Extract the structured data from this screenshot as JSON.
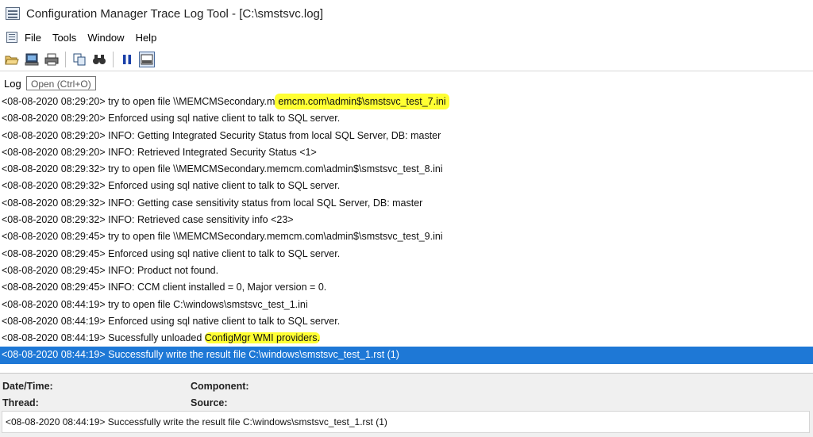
{
  "window": {
    "title": "Configuration Manager Trace Log Tool - [C:\\smstsvc.log]"
  },
  "menu": {
    "items": [
      "File",
      "Tools",
      "Window",
      "Help"
    ]
  },
  "toolbar": {
    "buttons": [
      "open-folder-icon",
      "computer-icon",
      "print-icon",
      "copy-icon",
      "find-icon",
      "pause-icon",
      "detail-pane-icon"
    ]
  },
  "log_header": {
    "label": "Log",
    "tooltip": "Open (Ctrl+O)"
  },
  "log_rows": [
    {
      "time": "<08-08-2020 08:29:20>",
      "text": " try to open file \\\\MEMCMSecondary.m",
      "hl": "emcm.com\\admin$\\smstsvc_test_7.ini",
      "rest": ""
    },
    {
      "time": "<08-08-2020 08:29:20>",
      "text": " Enforced using sql native client to talk to SQL server.",
      "hl": "",
      "rest": ""
    },
    {
      "time": "<08-08-2020 08:29:20>",
      "text": " INFO: Getting Integrated Security Status from local SQL Server, DB: master",
      "hl": "",
      "rest": ""
    },
    {
      "time": "<08-08-2020 08:29:20>",
      "text": " INFO: Retrieved Integrated Security Status <1>",
      "hl": "",
      "rest": ""
    },
    {
      "time": "<08-08-2020 08:29:32>",
      "text": " try to open file \\\\MEMCMSecondary.memcm.com\\admin$\\smstsvc_test_8.ini",
      "hl": "",
      "rest": ""
    },
    {
      "time": "<08-08-2020 08:29:32>",
      "text": " Enforced using sql native client to talk to SQL server.",
      "hl": "",
      "rest": ""
    },
    {
      "time": "<08-08-2020 08:29:32>",
      "text": " INFO: Getting case sensitivity status from local SQL Server, DB: master",
      "hl": "",
      "rest": ""
    },
    {
      "time": "<08-08-2020 08:29:32>",
      "text": " INFO: Retrieved case sensitivity info <23>",
      "hl": "",
      "rest": ""
    },
    {
      "time": "<08-08-2020 08:29:45>",
      "text": " try to open file \\\\MEMCMSecondary.memcm.com\\admin$\\smstsvc_test_9.ini",
      "hl": "",
      "rest": ""
    },
    {
      "time": "<08-08-2020 08:29:45>",
      "text": " Enforced using sql native client to talk to SQL server.",
      "hl": "",
      "rest": ""
    },
    {
      "time": "<08-08-2020 08:29:45>",
      "text": " INFO: Product not found.",
      "hl": "",
      "rest": ""
    },
    {
      "time": "<08-08-2020 08:29:45>",
      "text": " INFO: CCM client installed = 0, Major version = 0.",
      "hl": "",
      "rest": ""
    },
    {
      "time": "<08-08-2020 08:44:19>",
      "text": " try to open file C:\\windows\\smstsvc_test_1.ini",
      "hl": "",
      "rest": ""
    },
    {
      "time": "<08-08-2020 08:44:19>",
      "text": " Enforced using sql native client to talk to SQL server.",
      "hl": "",
      "rest": ""
    },
    {
      "time": "<08-08-2020 08:44:19>",
      "text": " Sucessfully unloaded ",
      "hl": "ConfigMgr WMI providers.",
      "rest": ""
    },
    {
      "time": "<08-08-2020 08:44:19>",
      "text": " Successfully write the result file C:\\windows\\smstsvc_test_1.rst (1)",
      "hl": "",
      "rest": "",
      "selected": true
    }
  ],
  "details": {
    "datetime_label": "Date/Time:",
    "component_label": "Component:",
    "thread_label": "Thread:",
    "source_label": "Source:",
    "message": "<08-08-2020 08:44:19> Successfully write the result file C:\\windows\\smstsvc_test_1.rst (1)"
  },
  "colors": {
    "selection": "#1e78d6",
    "highlight": "#ffff33"
  }
}
